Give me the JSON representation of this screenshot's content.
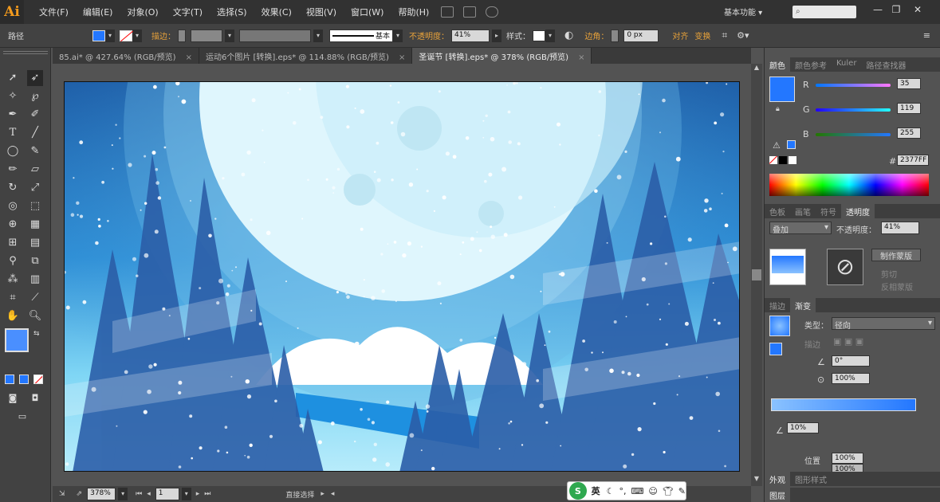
{
  "app": {
    "logo": "Ai"
  },
  "menu": [
    "文件(F)",
    "编辑(E)",
    "对象(O)",
    "文字(T)",
    "选择(S)",
    "效果(C)",
    "视图(V)",
    "窗口(W)",
    "帮助(H)"
  ],
  "workspace": "基本功能",
  "control": {
    "object_type": "路径",
    "stroke_label": "描边：",
    "stroke_style": "基本",
    "opacity_label": "不透明度：",
    "opacity_value": "41%",
    "style_label": "样式：",
    "corner_label": "边角：",
    "corner_value": "0 px",
    "align_label": "对齐",
    "transform_label": "变换"
  },
  "tabs": [
    {
      "label": "85.ai* @ 427.64% (RGB/预览)",
      "close": "×"
    },
    {
      "label": "运动6个图片 [转换].eps* @ 114.88% (RGB/预览)",
      "close": "×"
    },
    {
      "label": "圣诞节 [转换].eps* @ 378% (RGB/预览)",
      "close": "×"
    }
  ],
  "status": {
    "zoom": "378%",
    "page": "1",
    "info": "直接选择"
  },
  "color_panel": {
    "tabs": [
      "颜色",
      "颜色参考",
      "Kuler",
      "路径查找器"
    ],
    "r_label": "R",
    "r": "35",
    "g_label": "G",
    "g": "119",
    "b_label": "B",
    "b": "255",
    "hex_label": "#",
    "hex": "2377FF",
    "fill_color": "#2377ff"
  },
  "transparency_panel": {
    "tabs": [
      "色板",
      "画笔",
      "符号",
      "透明度"
    ],
    "blend": "叠加",
    "opacity_label": "不透明度：",
    "opacity": "41%",
    "make_mask": "制作蒙版",
    "clip": "剪切",
    "invert": "反相蒙版"
  },
  "gradient_panel": {
    "tabs": [
      "描边",
      "渐变"
    ],
    "type_label": "类型：",
    "type": "径向",
    "stroke_label": "描边",
    "angle": "0°",
    "ratio": "100%",
    "stop_opacity": "10%",
    "location_label": "位置",
    "location": "100%",
    "stop_opacity2": "100%"
  },
  "bottom_tabs": [
    "外观",
    "图形样式"
  ],
  "bottom_tabs2": [
    "图层"
  ],
  "ime": {
    "brand": "S",
    "lang": "英"
  }
}
